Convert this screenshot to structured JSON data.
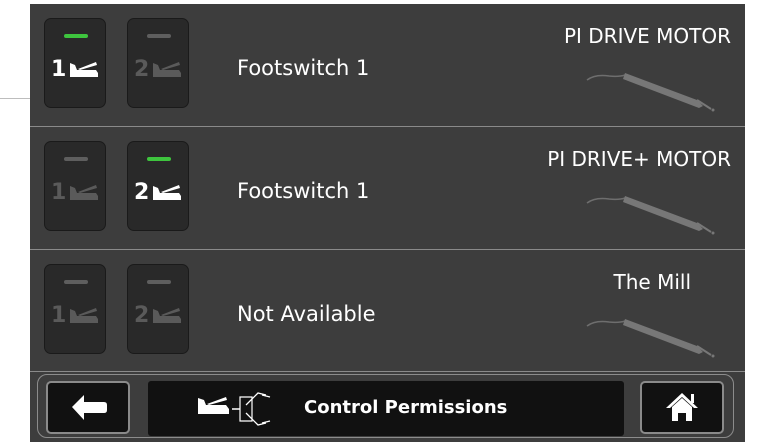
{
  "rows": [
    {
      "footswitch": [
        {
          "number": "1",
          "active": true,
          "led_on": true
        },
        {
          "number": "2",
          "active": false,
          "led_on": false
        }
      ],
      "status": "Footswitch 1",
      "tool_name": "PI DRIVE MOTOR",
      "tool_icon": "handpiece-icon"
    },
    {
      "footswitch": [
        {
          "number": "1",
          "active": false,
          "led_on": false
        },
        {
          "number": "2",
          "active": true,
          "led_on": true
        }
      ],
      "status": "Footswitch 1",
      "tool_name": "PI DRIVE+ MOTOR",
      "tool_icon": "handpiece-icon"
    },
    {
      "footswitch": [
        {
          "number": "1",
          "active": false,
          "led_on": false
        },
        {
          "number": "2",
          "active": false,
          "led_on": false
        }
      ],
      "status": "Not Available",
      "tool_name": "The Mill",
      "tool_icon": "handpiece-icon"
    }
  ],
  "bottom_bar": {
    "title": "Control Permissions",
    "back_icon": "arrow-left-icon",
    "home_icon": "home-icon",
    "title_icon": "footswitch-handpiece-icon"
  },
  "colors": {
    "panel": "#3d3d3d",
    "button": "#292929",
    "led_on": "#3ec43e",
    "led_off": "#5e5e5e",
    "text": "#ffffff"
  }
}
